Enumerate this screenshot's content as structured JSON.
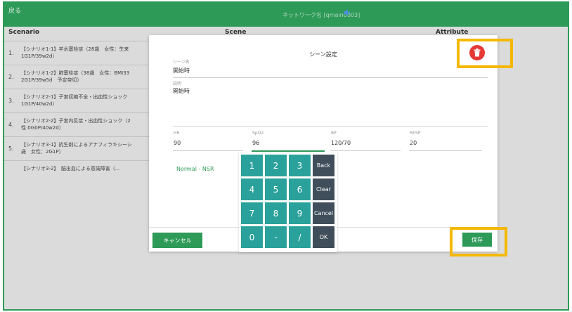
{
  "topbar": {
    "back_label": "戻る",
    "network_label": "ネットワーク名 [qmain0003]"
  },
  "columns": {
    "scenario": "Scenario",
    "scene": "Scene",
    "attribute": "Attribute"
  },
  "scenarios": [
    {
      "index": "1.",
      "text": "【シナリオ1-1】羊水塞栓症（28歳　女性：生来\n1G1P/39w2d）"
    },
    {
      "index": "2.",
      "text": "【シナリオ1-2】肺塞栓症（38歳　女性：BMI33\n2G1P/39w5d　予定帝切）"
    },
    {
      "index": "3.",
      "text": "【シナリオ2-1】子宮収縮不全・出血性ショック\n1G1P/40w2d）"
    },
    {
      "index": "4.",
      "text": "【シナリオ2-2】子宮内反症・出血性ショック（2\n性:0G0P/40w2d）"
    },
    {
      "index": "5.",
      "text": "【シナリオ3-1】抗生剤によるアナフィラキシーシ\n歳　女性：2G1P）"
    },
    {
      "index": "",
      "text": "【シナリオ3-2】　脳出血による意識障害（..."
    }
  ],
  "modal": {
    "title": "シーン設定",
    "scene_name_label": "シーン名",
    "scene_name_value": "開始時",
    "description_label": "説明",
    "description_value": "開始時",
    "vitals": {
      "hr_label": "HR",
      "hr_value": "90",
      "spo2_label": "SpO2",
      "spo2_value": "96",
      "bp_label": "BP",
      "bp_value": "120/70",
      "resp_label": "RESP",
      "resp_value": "20"
    },
    "rhythm": "Normal - NSR",
    "cancel_label": "キャンセル",
    "save_label": "保存"
  },
  "keypad": [
    {
      "label": "1",
      "type": "num"
    },
    {
      "label": "2",
      "type": "num"
    },
    {
      "label": "3",
      "type": "num"
    },
    {
      "label": "Back",
      "type": "fn"
    },
    {
      "label": "4",
      "type": "num"
    },
    {
      "label": "5",
      "type": "num"
    },
    {
      "label": "6",
      "type": "num"
    },
    {
      "label": "Clear",
      "type": "fn"
    },
    {
      "label": "7",
      "type": "num"
    },
    {
      "label": "8",
      "type": "num"
    },
    {
      "label": "9",
      "type": "num"
    },
    {
      "label": "Cancel",
      "type": "fn"
    },
    {
      "label": "0",
      "type": "num"
    },
    {
      "label": "-",
      "type": "num"
    },
    {
      "label": "/",
      "type": "num"
    },
    {
      "label": "OK",
      "type": "fn"
    }
  ],
  "colors": {
    "brand_green": "#2e9a58",
    "keypad_teal": "#2aa19a",
    "keypad_dark": "#3f4e5a",
    "delete_red": "#e53935",
    "highlight_yellow": "#f5b800"
  },
  "icons": {
    "speaker": "speaker-icon",
    "delete": "trash-icon"
  }
}
